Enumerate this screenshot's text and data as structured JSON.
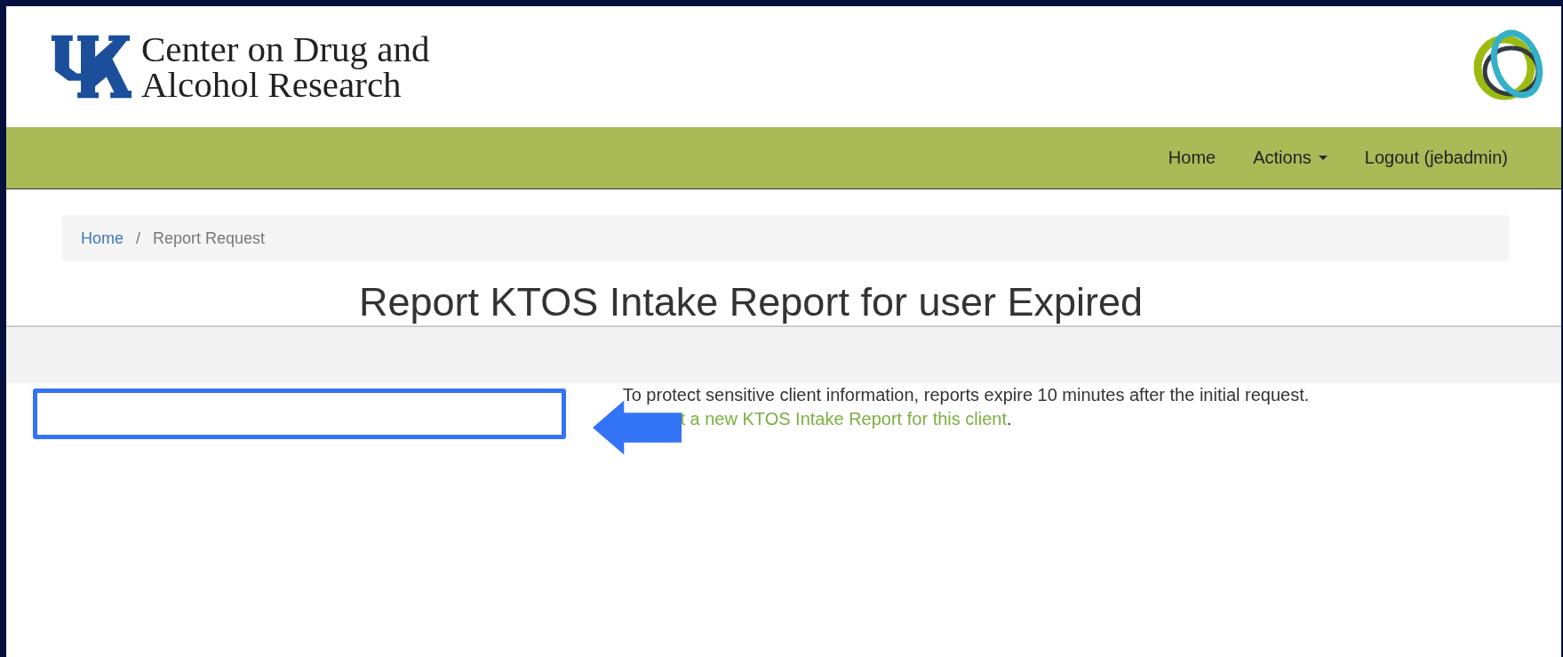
{
  "header": {
    "title_line_1": "Center on Drug and",
    "title_line_2": "Alcohol Research"
  },
  "navbar": {
    "items": [
      {
        "label": "Home",
        "kind": "link"
      },
      {
        "label": "Actions",
        "kind": "dropdown"
      },
      {
        "label": "Logout (jebadmin)",
        "kind": "link"
      }
    ]
  },
  "breadcrumb": [
    {
      "label": "Home",
      "kind": "link"
    },
    {
      "label": "/",
      "kind": "separator"
    },
    {
      "label": "Report Request",
      "kind": "current"
    }
  ],
  "heading": "Report KTOS Intake Report for user Expired",
  "message": "To protect sensitive client information, reports expire 10 minutes after the initial request.",
  "request_link": {
    "text": "t a new KTOS Intake Report for this client",
    "suffix": "."
  }
}
